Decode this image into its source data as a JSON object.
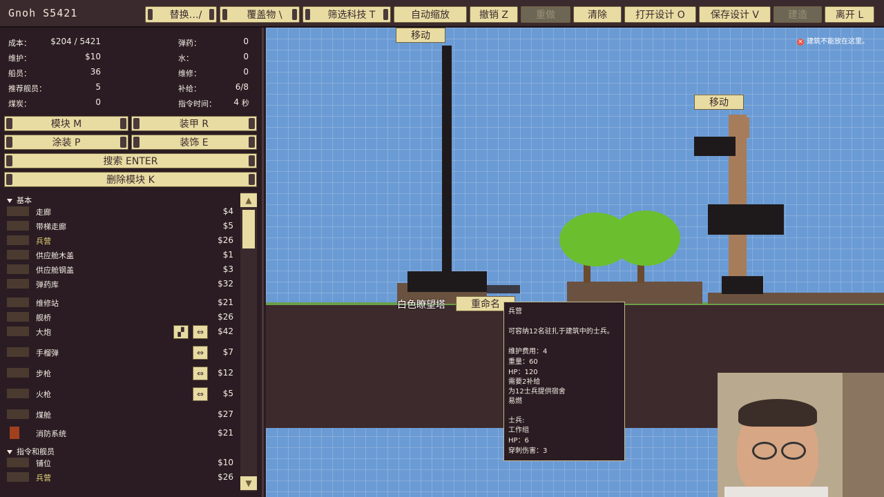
{
  "topbar": {
    "title": "Gnoh S5421",
    "buttons": [
      {
        "label": "替换…/",
        "enabled": true
      },
      {
        "label": "覆盖物 \\",
        "enabled": true
      },
      {
        "label": "筛选科技 T",
        "enabled": true
      },
      {
        "label": "自动缩放",
        "enabled": true
      },
      {
        "label": "撤销 Z",
        "enabled": true
      },
      {
        "label": "重做",
        "enabled": false
      },
      {
        "label": "清除",
        "enabled": true
      },
      {
        "label": "打开设计 O",
        "enabled": true
      },
      {
        "label": "保存设计 V",
        "enabled": true
      },
      {
        "label": "建造",
        "enabled": false
      },
      {
        "label": "离开 L",
        "enabled": true
      }
    ]
  },
  "stats": {
    "cost_label": "成本：",
    "cost_value": "$204 / 5421",
    "upkeep_label": "维护：",
    "upkeep_value": "$10",
    "crew_label": "船员：",
    "crew_value": "36",
    "rec_crew_label": "推荐舰员：",
    "rec_crew_value": "5",
    "coal_label": "煤炭：",
    "coal_value": "0",
    "ammo_label": "弹药：",
    "ammo_value": "0",
    "water_label": "水：",
    "water_value": "0",
    "repair_label": "维修：",
    "repair_value": "0",
    "supply_label": "补给：",
    "supply_value": "6/8",
    "cmd_label": "指令时间：",
    "cmd_value": "4",
    "cmd_unit": "秒"
  },
  "panel_buttons": {
    "module": "模块 M",
    "armor": "装甲 R",
    "paint": "涂装 P",
    "decor": "装饰 E",
    "search": "搜索 ENTER",
    "delete": "删除模块 K"
  },
  "categories": [
    {
      "label": "基本"
    },
    {
      "label": "指令和舰员"
    }
  ],
  "items": [
    {
      "name": "走廊",
      "price": "$4",
      "selected": false
    },
    {
      "name": "带梯走廊",
      "price": "$5",
      "selected": false
    },
    {
      "name": "兵营",
      "price": "$26",
      "selected": true
    },
    {
      "name": "供应舱木盖",
      "price": "$1",
      "selected": false
    },
    {
      "name": "供应舱钢盖",
      "price": "$3",
      "selected": false
    },
    {
      "name": "弹药库",
      "price": "$32",
      "selected": false
    },
    {
      "name": "维修站",
      "price": "$21",
      "selected": false
    },
    {
      "name": "舰桥",
      "price": "$26",
      "selected": false
    },
    {
      "name": "大炮",
      "price": "$42",
      "selected": false
    },
    {
      "name": "手榴弹",
      "price": "$7",
      "selected": false
    },
    {
      "name": "步枪",
      "price": "$12",
      "selected": false
    },
    {
      "name": "火枪",
      "price": "$5",
      "selected": false
    },
    {
      "name": "煤舱",
      "price": "$27",
      "selected": false
    },
    {
      "name": "消防系统",
      "price": "$21",
      "selected": false
    },
    {
      "name": "铺位",
      "price": "$10",
      "selected": false
    },
    {
      "name": "兵营",
      "price": "$26",
      "selected": true
    }
  ],
  "icons": {
    "rotate": "⇔",
    "tool": "▞",
    "scroll_up": "▲",
    "scroll_down": "▼"
  },
  "game": {
    "move_label_1": "移动",
    "move_label_2": "移动",
    "ship_name": "白色瞭望塔",
    "rename_label": "重命名",
    "warning": "建筑不能放在这里。"
  },
  "tooltip": {
    "title": "兵营",
    "desc": "可容纳12名驻扎于建筑中的士兵。",
    "upkeep": "维护费用：4",
    "weight": "重量：60",
    "hp": "HP：120",
    "needs": "需要2补给",
    "provides": "为12士兵提供宿舍",
    "flammable": "易燃",
    "soldier_header": "士兵:",
    "soldier_type": "工作组",
    "soldier_hp": "HP：6",
    "soldier_dmg": "穿刺伤害：3"
  },
  "colors": {
    "accent": "#e8dca2",
    "panel": "#2a1c22",
    "sky": "#6b9bd4",
    "selected_text": "#e8d57a"
  }
}
